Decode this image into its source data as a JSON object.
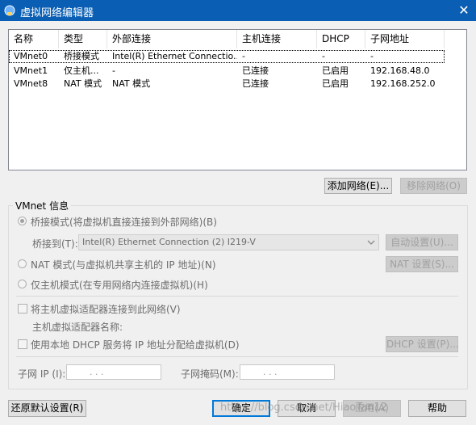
{
  "window": {
    "title": "虚拟网络编辑器",
    "close_glyph": "✕"
  },
  "columns": [
    "名称",
    "类型",
    "外部连接",
    "主机连接",
    "DHCP",
    "子网地址"
  ],
  "rows": [
    [
      "VMnet0",
      "桥接模式",
      "Intel(R) Ethernet Connectio...",
      "-",
      "-",
      "-"
    ],
    [
      "VMnet1",
      "仅主机...",
      "-",
      "已连接",
      "已启用",
      "192.168.48.0"
    ],
    [
      "VMnet8",
      "NAT 模式",
      "NAT 模式",
      "已连接",
      "已启用",
      "192.168.252.0"
    ]
  ],
  "buttons": {
    "add_network": "添加网络(E)...",
    "remove_network": "移除网络(O)",
    "restore_defaults": "还原默认设置(R)",
    "ok": "确定",
    "cancel": "取消",
    "apply": "应用(A)",
    "help": "帮助",
    "auto_settings": "自动设置(U)...",
    "nat_settings": "NAT 设置(S)...",
    "dhcp_settings": "DHCP 设置(P)..."
  },
  "vmnet_info": {
    "group_label": "VMnet 信息",
    "bridged_label": "桥接模式(将虚拟机直接连接到外部网络)(B)",
    "bridged_to_label": "桥接到(T):",
    "bridged_to_value": "Intel(R) Ethernet Connection (2) I219-V",
    "nat_label": "NAT 模式(与虚拟机共享主机的 IP 地址)(N)",
    "hostonly_label": "仅主机模式(在专用网络内连接虚拟机)(H)",
    "connect_adapter_label": "将主机虚拟适配器连接到此网络(V)",
    "adapter_name_label": "主机虚拟适配器名称:",
    "use_dhcp_label": "使用本地 DHCP 服务将 IP 地址分配给虚拟机(D)",
    "subnet_ip_label": "子网 IP (I):",
    "subnet_mask_label": "子网掩码(M):",
    "ip_placeholder": ".     .     ."
  },
  "watermark": "https://blog.csdn.net/HiaoTan12",
  "colors": {
    "titlebar": "#0a5fb4",
    "accent": "#0078d7"
  }
}
